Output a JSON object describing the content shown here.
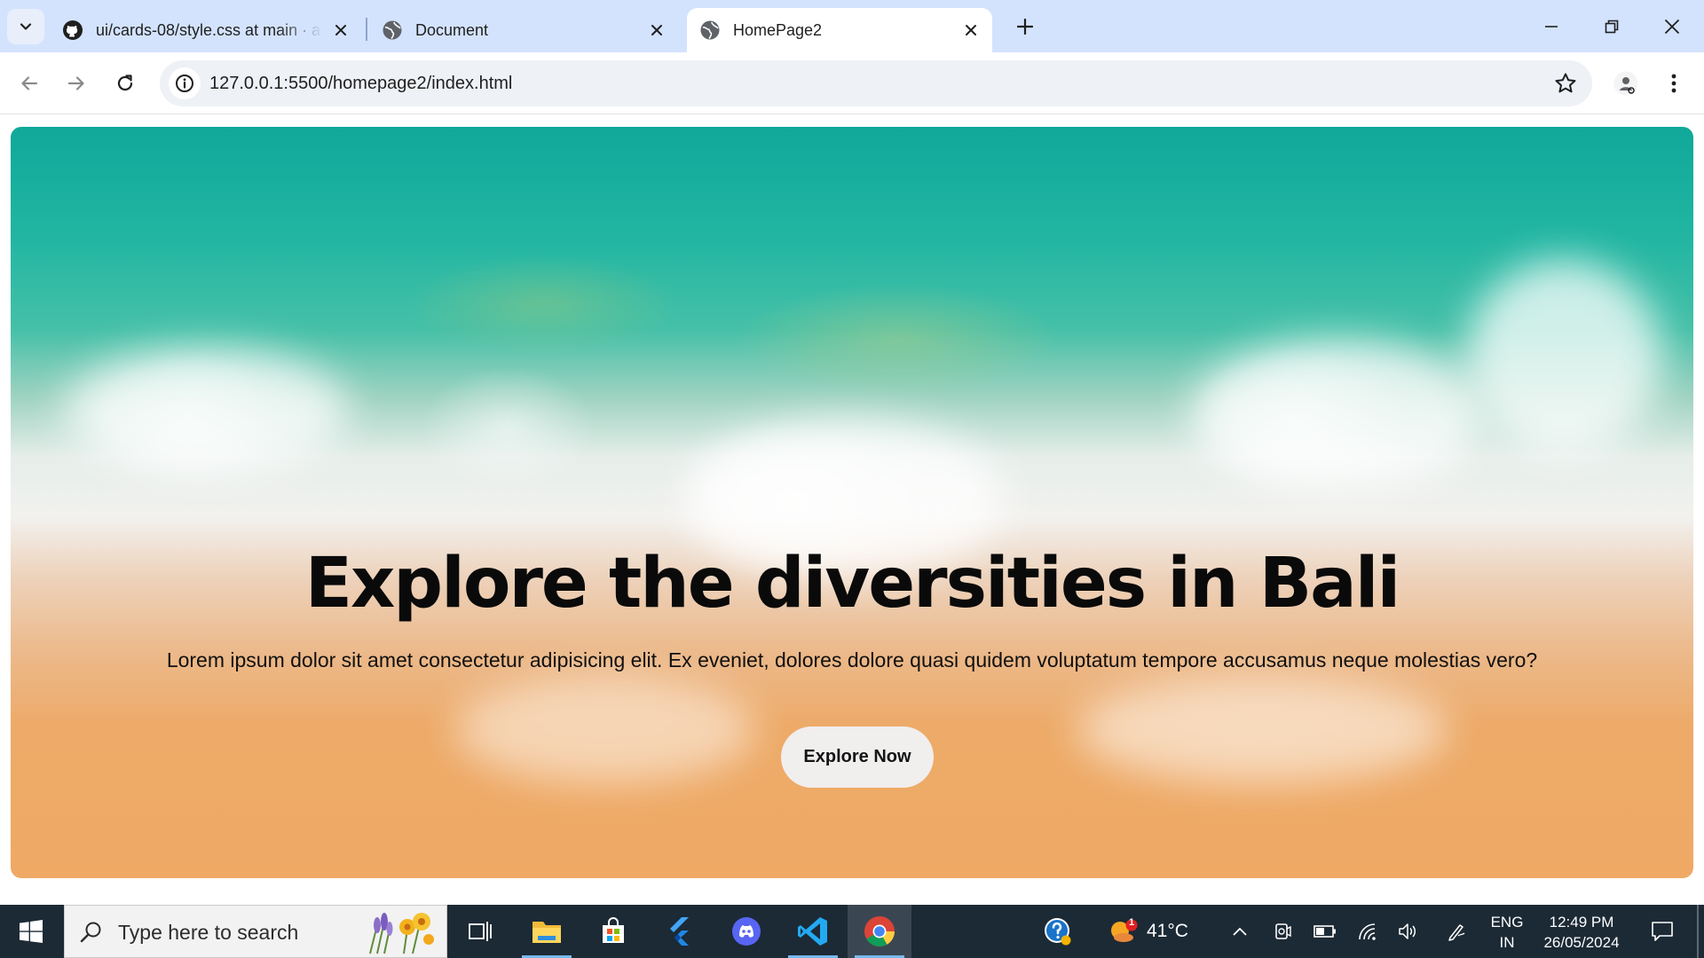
{
  "browser": {
    "tabs": [
      {
        "title": "ui/cards-08/style.css at main · a",
        "favicon": "github-icon",
        "active": false
      },
      {
        "title": "Document",
        "favicon": "globe-icon",
        "active": false
      },
      {
        "title": "HomePage2",
        "favicon": "globe-icon",
        "active": true
      }
    ],
    "url": "127.0.0.1:5500/homepage2/index.html"
  },
  "page": {
    "hero": {
      "title": "Explore the diversities in Bali",
      "text": "Lorem ipsum dolor sit amet consectetur adipisicing elit. Ex eveniet, dolores dolore quasi quidem voluptatum tempore accusamus neque molestias vero?",
      "button_label": "Explore Now"
    }
  },
  "taskbar": {
    "search_placeholder": "Type here to search",
    "apps": [
      "task-view-icon",
      "file-explorer-icon",
      "microsoft-store-icon",
      "flutter-icon",
      "discord-icon",
      "vscode-icon",
      "chrome-icon"
    ],
    "weather": {
      "temperature": "41°C",
      "badge": "1"
    },
    "language": {
      "line1": "ENG",
      "line2": "IN"
    },
    "clock": {
      "time": "12:49 PM",
      "date": "26/05/2024"
    }
  }
}
